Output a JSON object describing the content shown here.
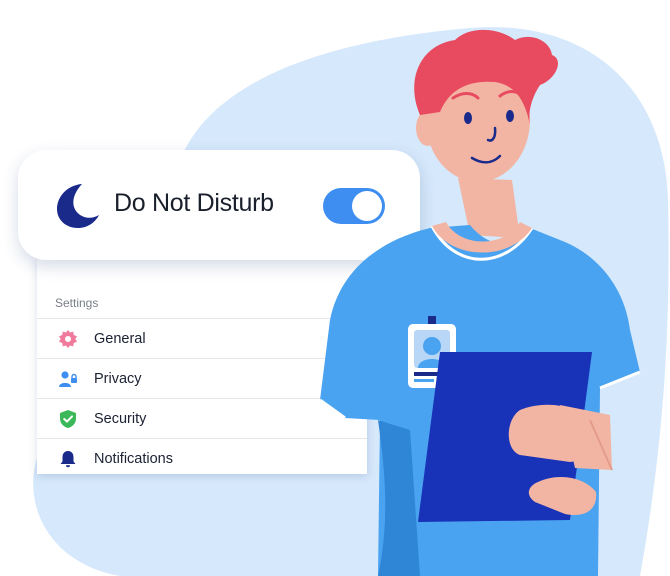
{
  "dnd": {
    "label": "Do Not Disturb",
    "enabled": true,
    "toggle_color": "#3d8ef0",
    "icon": "moon-icon"
  },
  "settings": {
    "header": "Settings",
    "items": [
      {
        "label": "General",
        "icon": "gear-icon"
      },
      {
        "label": "Privacy",
        "icon": "user-lock-icon"
      },
      {
        "label": "Security",
        "icon": "shield-check-icon"
      },
      {
        "label": "Notifications",
        "icon": "bell-icon"
      }
    ]
  },
  "colors": {
    "background_blob": "#d6e8fb",
    "moon": "#1a2a8a",
    "shirt": "#4aa3f0",
    "clipboard": "#1832b8",
    "hair": "#e84a5f",
    "skin": "#f2b5a3"
  }
}
